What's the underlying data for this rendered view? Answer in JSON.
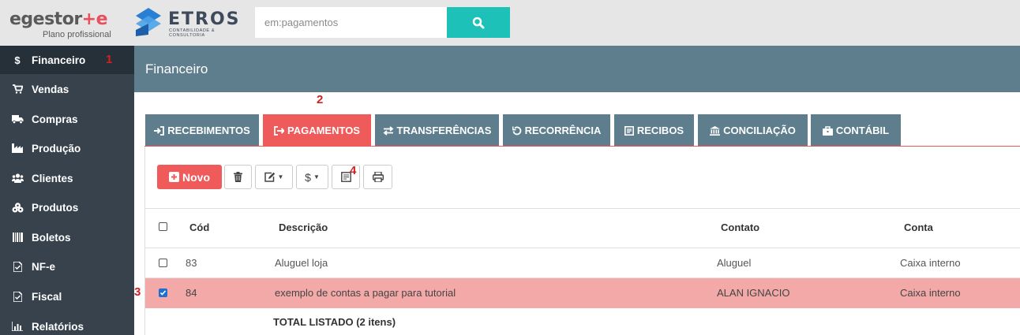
{
  "header": {
    "logo_egestor": {
      "text_part": "egestor",
      "plan": "Plano profissional"
    },
    "logo_etros": {
      "name": "ETROS",
      "tagline": "CONTABILIDADE & CONSULTORIA"
    },
    "search": {
      "placeholder": "em:pagamentos"
    }
  },
  "sidebar": {
    "items": [
      {
        "label": "Financeiro",
        "icon": "dollar-icon",
        "active": true
      },
      {
        "label": "Vendas",
        "icon": "cart-icon"
      },
      {
        "label": "Compras",
        "icon": "truck-icon"
      },
      {
        "label": "Produção",
        "icon": "industry-icon"
      },
      {
        "label": "Clientes",
        "icon": "users-icon"
      },
      {
        "label": "Produtos",
        "icon": "cubes-icon"
      },
      {
        "label": "Boletos",
        "icon": "barcode-icon"
      },
      {
        "label": "NF-e",
        "icon": "document-icon"
      },
      {
        "label": "Fiscal",
        "icon": "document-icon"
      },
      {
        "label": "Relatórios",
        "icon": "bar-chart-icon"
      }
    ]
  },
  "page": {
    "title": "Financeiro"
  },
  "tabs": [
    {
      "label": "RECEBIMENTOS",
      "icon": "sign-in-icon"
    },
    {
      "label": "PAGAMENTOS",
      "icon": "sign-out-icon",
      "active": true
    },
    {
      "label": "TRANSFERÊNCIAS",
      "icon": "exchange-icon"
    },
    {
      "label": "RECORRÊNCIA",
      "icon": "undo-icon"
    },
    {
      "label": "RECIBOS",
      "icon": "receipt-icon"
    },
    {
      "label": "CONCILIAÇÃO",
      "icon": "bank-icon"
    },
    {
      "label": "CONTÁBIL",
      "icon": "briefcase-icon"
    }
  ],
  "toolbar": {
    "novo_label": "Novo"
  },
  "table": {
    "columns": [
      "Cód",
      "Descrição",
      "Contato",
      "Conta"
    ],
    "rows": [
      {
        "cod": "83",
        "descricao": "Aluguel loja",
        "contato": "Aluguel",
        "conta": "Caixa interno",
        "checked": false
      },
      {
        "cod": "84",
        "descricao": "exemplo de contas a pagar para tutorial",
        "contato": "ALAN IGNACIO",
        "conta": "Caixa interno",
        "checked": true
      }
    ],
    "total_label": "TOTAL LISTADO (2 itens)"
  },
  "annotations": [
    "1",
    "2",
    "3",
    "4"
  ],
  "colors": {
    "accent": "#ef5a5a",
    "tab": "#5f7e8d",
    "sidebar": "#37424d",
    "search_button": "#1dc1b8",
    "selected_row": "#f4a9a9"
  }
}
